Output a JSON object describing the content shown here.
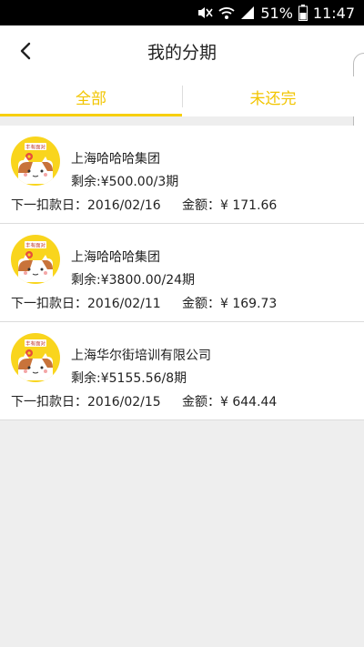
{
  "status_bar": {
    "battery_percent": "51%",
    "time": "11:47"
  },
  "header": {
    "title": "我的分期"
  },
  "tabs": [
    {
      "label": "全部",
      "active": true
    },
    {
      "label": "未还完",
      "active": false
    }
  ],
  "accent_color": "#f7cf0a",
  "avatar_text": "丰有面对",
  "items": [
    {
      "company": "上海哈哈哈集团",
      "remain_label": "剩余:",
      "remain_value": "¥500.00/3期",
      "due_label": "下一扣款日：",
      "due_date": "2016/02/16",
      "amount_label": "金额：",
      "amount_value": "¥ 171.66"
    },
    {
      "company": "上海哈哈哈集团",
      "remain_label": "剩余:",
      "remain_value": "¥3800.00/24期",
      "due_label": "下一扣款日：",
      "due_date": "2016/02/11",
      "amount_label": "金额：",
      "amount_value": "¥ 169.73"
    },
    {
      "company": "上海华尔街培训有限公司",
      "remain_label": "剩余:",
      "remain_value": "¥5155.56/8期",
      "due_label": "下一扣款日：",
      "due_date": "2016/02/15",
      "amount_label": "金额：",
      "amount_value": "¥ 644.44"
    }
  ]
}
